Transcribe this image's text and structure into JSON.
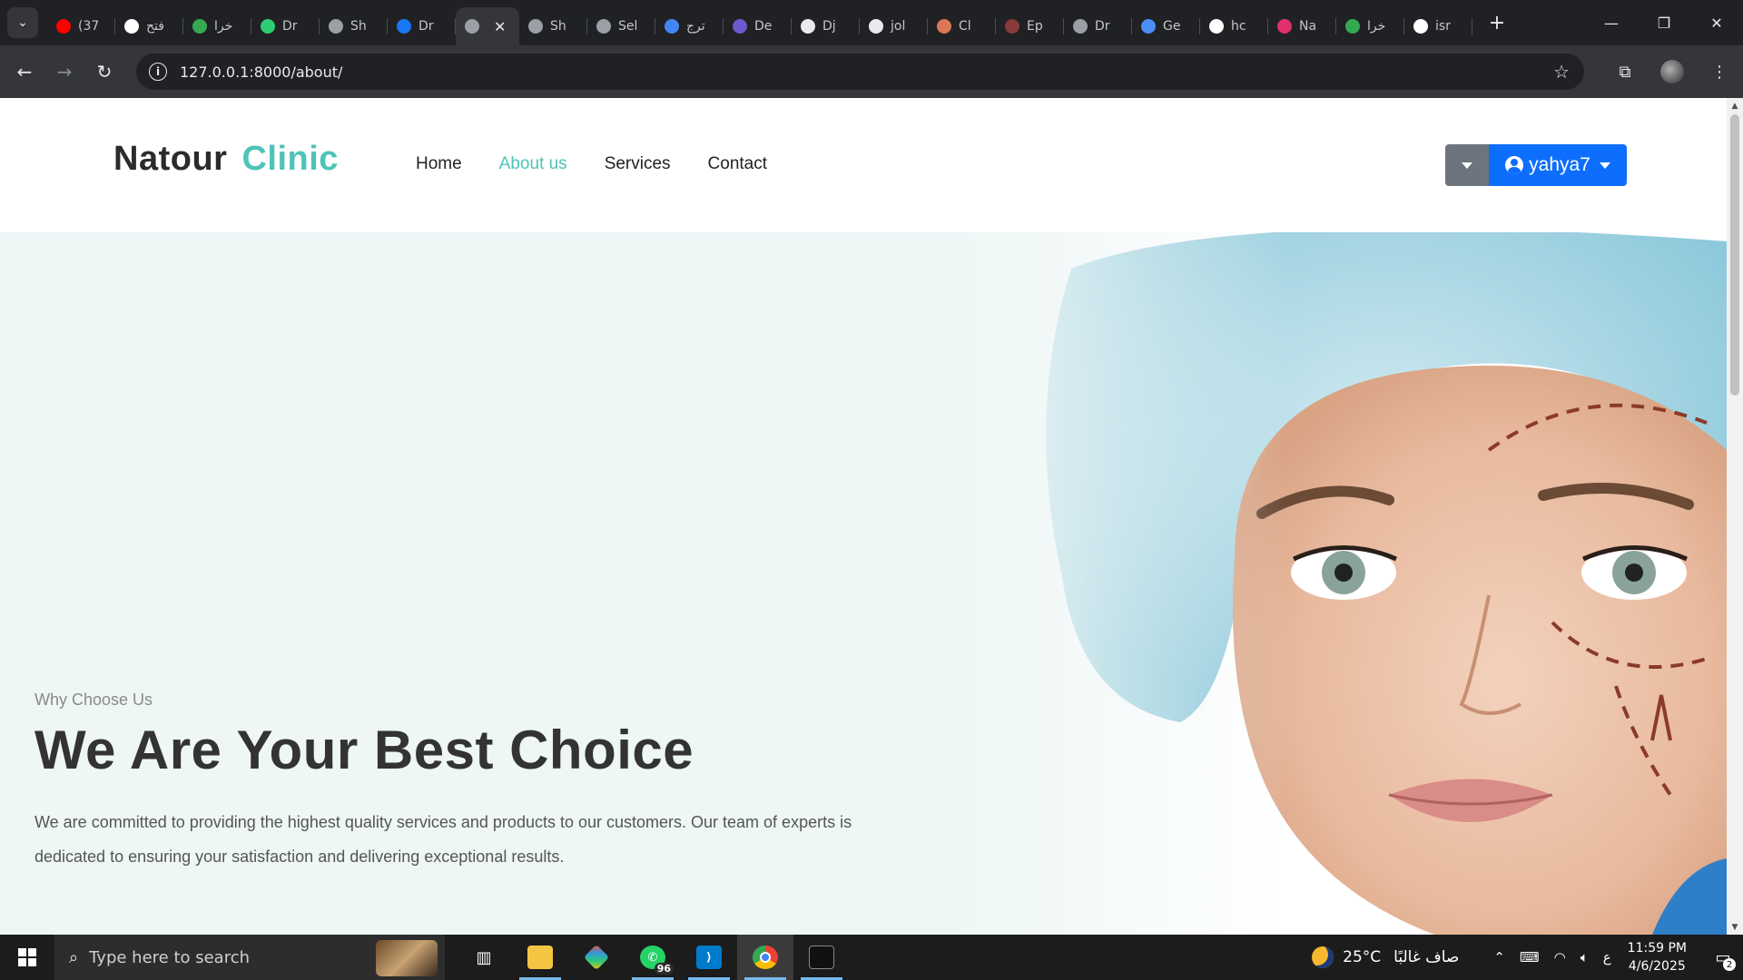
{
  "browser": {
    "tabs": [
      {
        "title": "(37",
        "favicon": "youtube-icon",
        "color": "#ff0000"
      },
      {
        "title": "فتح",
        "favicon": "openai-icon",
        "color": "#ffffff"
      },
      {
        "title": "خرا",
        "favicon": "maps-pin-icon",
        "color": "#34a853"
      },
      {
        "title": "Dr",
        "favicon": "asterisk-icon",
        "color": "#2ecc71"
      },
      {
        "title": "Sh",
        "favicon": "globe-icon",
        "color": "#9aa0a6"
      },
      {
        "title": "Dr",
        "favicon": "facebook-icon",
        "color": "#1877f2"
      },
      {
        "title": "",
        "favicon": "globe-icon",
        "color": "#9aa0a6",
        "active": true
      },
      {
        "title": "Sh",
        "favicon": "globe-icon",
        "color": "#9aa0a6"
      },
      {
        "title": "Sel",
        "favicon": "globe-icon",
        "color": "#9aa0a6"
      },
      {
        "title": "ترج",
        "favicon": "translate-icon",
        "color": "#4285f4"
      },
      {
        "title": "De",
        "favicon": "star-badge-icon",
        "color": "#6a5acd"
      },
      {
        "title": "Dj",
        "favicon": "slash-circle-icon",
        "color": "#e8eaed"
      },
      {
        "title": "jol",
        "favicon": "github-icon",
        "color": "#e8eaed"
      },
      {
        "title": "Cl",
        "favicon": "claude-icon",
        "color": "#d97757"
      },
      {
        "title": "Ep",
        "favicon": "square-e-icon",
        "color": "#8b3a3a"
      },
      {
        "title": "Dr",
        "favicon": "globe-icon",
        "color": "#9aa0a6"
      },
      {
        "title": "Ge",
        "favicon": "gemini-icon",
        "color": "#4c8df6"
      },
      {
        "title": "hc",
        "favicon": "google-icon",
        "color": "#ffffff"
      },
      {
        "title": "Na",
        "favicon": "instagram-icon",
        "color": "#e1306c"
      },
      {
        "title": "خرا",
        "favicon": "maps-pin-icon",
        "color": "#34a853"
      },
      {
        "title": "isr",
        "favicon": "google-icon",
        "color": "#ffffff"
      }
    ],
    "url": "127.0.0.1:8000/about/"
  },
  "site": {
    "logo_part1": "Natour",
    "logo_part2": "Clinic",
    "nav": [
      "Home",
      "About us",
      "Services",
      "Contact"
    ],
    "active_nav": "About us",
    "username": "yahya7",
    "accent_color": "#4fc3b8",
    "primary_button_color": "#0d6efd"
  },
  "hero": {
    "eyebrow": "Why Choose Us",
    "title": "We Are Your Best Choice",
    "body": "We are committed to providing the highest quality services and products to our customers. Our team of experts is dedicated to ensuring your satisfaction and delivering exceptional results."
  },
  "taskbar": {
    "search_placeholder": "Type here to search",
    "whatsapp_badge": "96",
    "weather_temp": "25°C",
    "weather_desc": "صاف غالبًا",
    "lang": "ع",
    "time": "11:59 PM",
    "date": "4/6/2025",
    "notification_count": "2"
  }
}
